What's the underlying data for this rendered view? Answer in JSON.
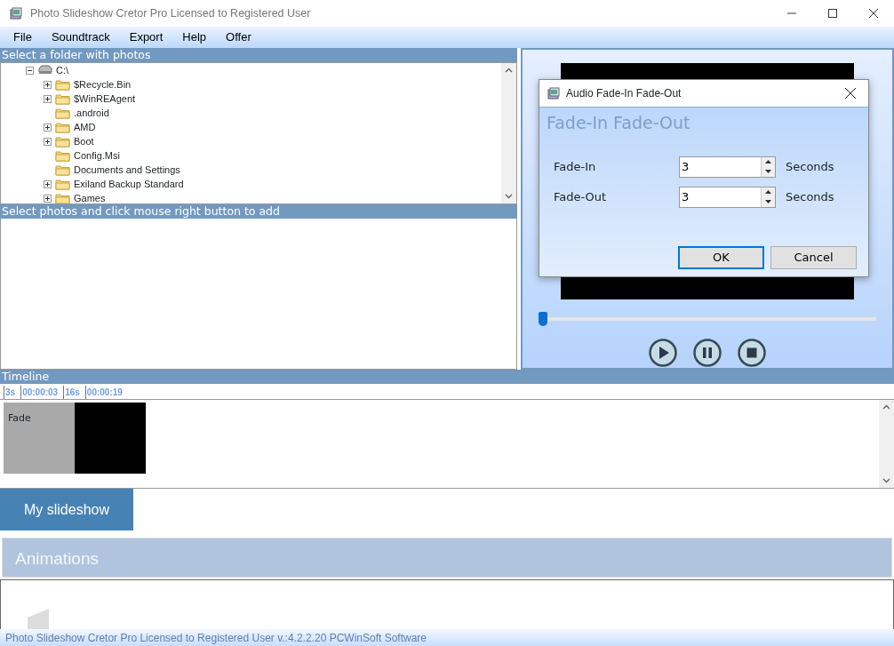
{
  "window": {
    "title": "Photo Slideshow Cretor Pro Licensed to Registered User"
  },
  "menu": [
    "File",
    "Soundtrack",
    "Export",
    "Help",
    "Offer"
  ],
  "folder_panel": {
    "header": "Select a folder with photos",
    "tree": [
      {
        "label": "C:\\",
        "expanded": true,
        "children": [
          {
            "label": "$Recycle.Bin",
            "expandable": true
          },
          {
            "label": "$WinREAgent",
            "expandable": true
          },
          {
            "label": ".android",
            "expandable": false
          },
          {
            "label": "AMD",
            "expandable": true
          },
          {
            "label": "Boot",
            "expandable": true
          },
          {
            "label": "Config.Msi",
            "expandable": false
          },
          {
            "label": "Documents and Settings",
            "expandable": false
          },
          {
            "label": "Exiland Backup Standard",
            "expandable": true
          },
          {
            "label": "Games",
            "expandable": true
          }
        ]
      }
    ]
  },
  "photos_panel": {
    "header": "Select photos and click mouse right button to add"
  },
  "preview": {
    "seek": {
      "level": 0
    }
  },
  "timeline": {
    "header": "Timeline",
    "ruler": [
      "3s",
      "00:00:03",
      "16s",
      "00:00:19"
    ],
    "clips": [
      {
        "kind": "transition",
        "label": "Fade"
      },
      {
        "kind": "black"
      }
    ]
  },
  "tabs": [
    {
      "label": "My slideshow",
      "selected": true
    }
  ],
  "animations": {
    "header": "Animations"
  },
  "status_bar": "Photo Slideshow Cretor Pro Licensed to Registered User v.:4.2.2.20 PCWinSoft Software",
  "dialog": {
    "title": "Audio Fade-In Fade-Out",
    "heading": "Fade-In Fade-Out",
    "fields": [
      {
        "label": "Fade-In",
        "value": "3",
        "unit": "Seconds"
      },
      {
        "label": "Fade-Out",
        "value": "3",
        "unit": "Seconds"
      }
    ],
    "buttons": [
      {
        "label": "OK",
        "default": true
      },
      {
        "label": "Cancel",
        "default": false
      }
    ]
  }
}
